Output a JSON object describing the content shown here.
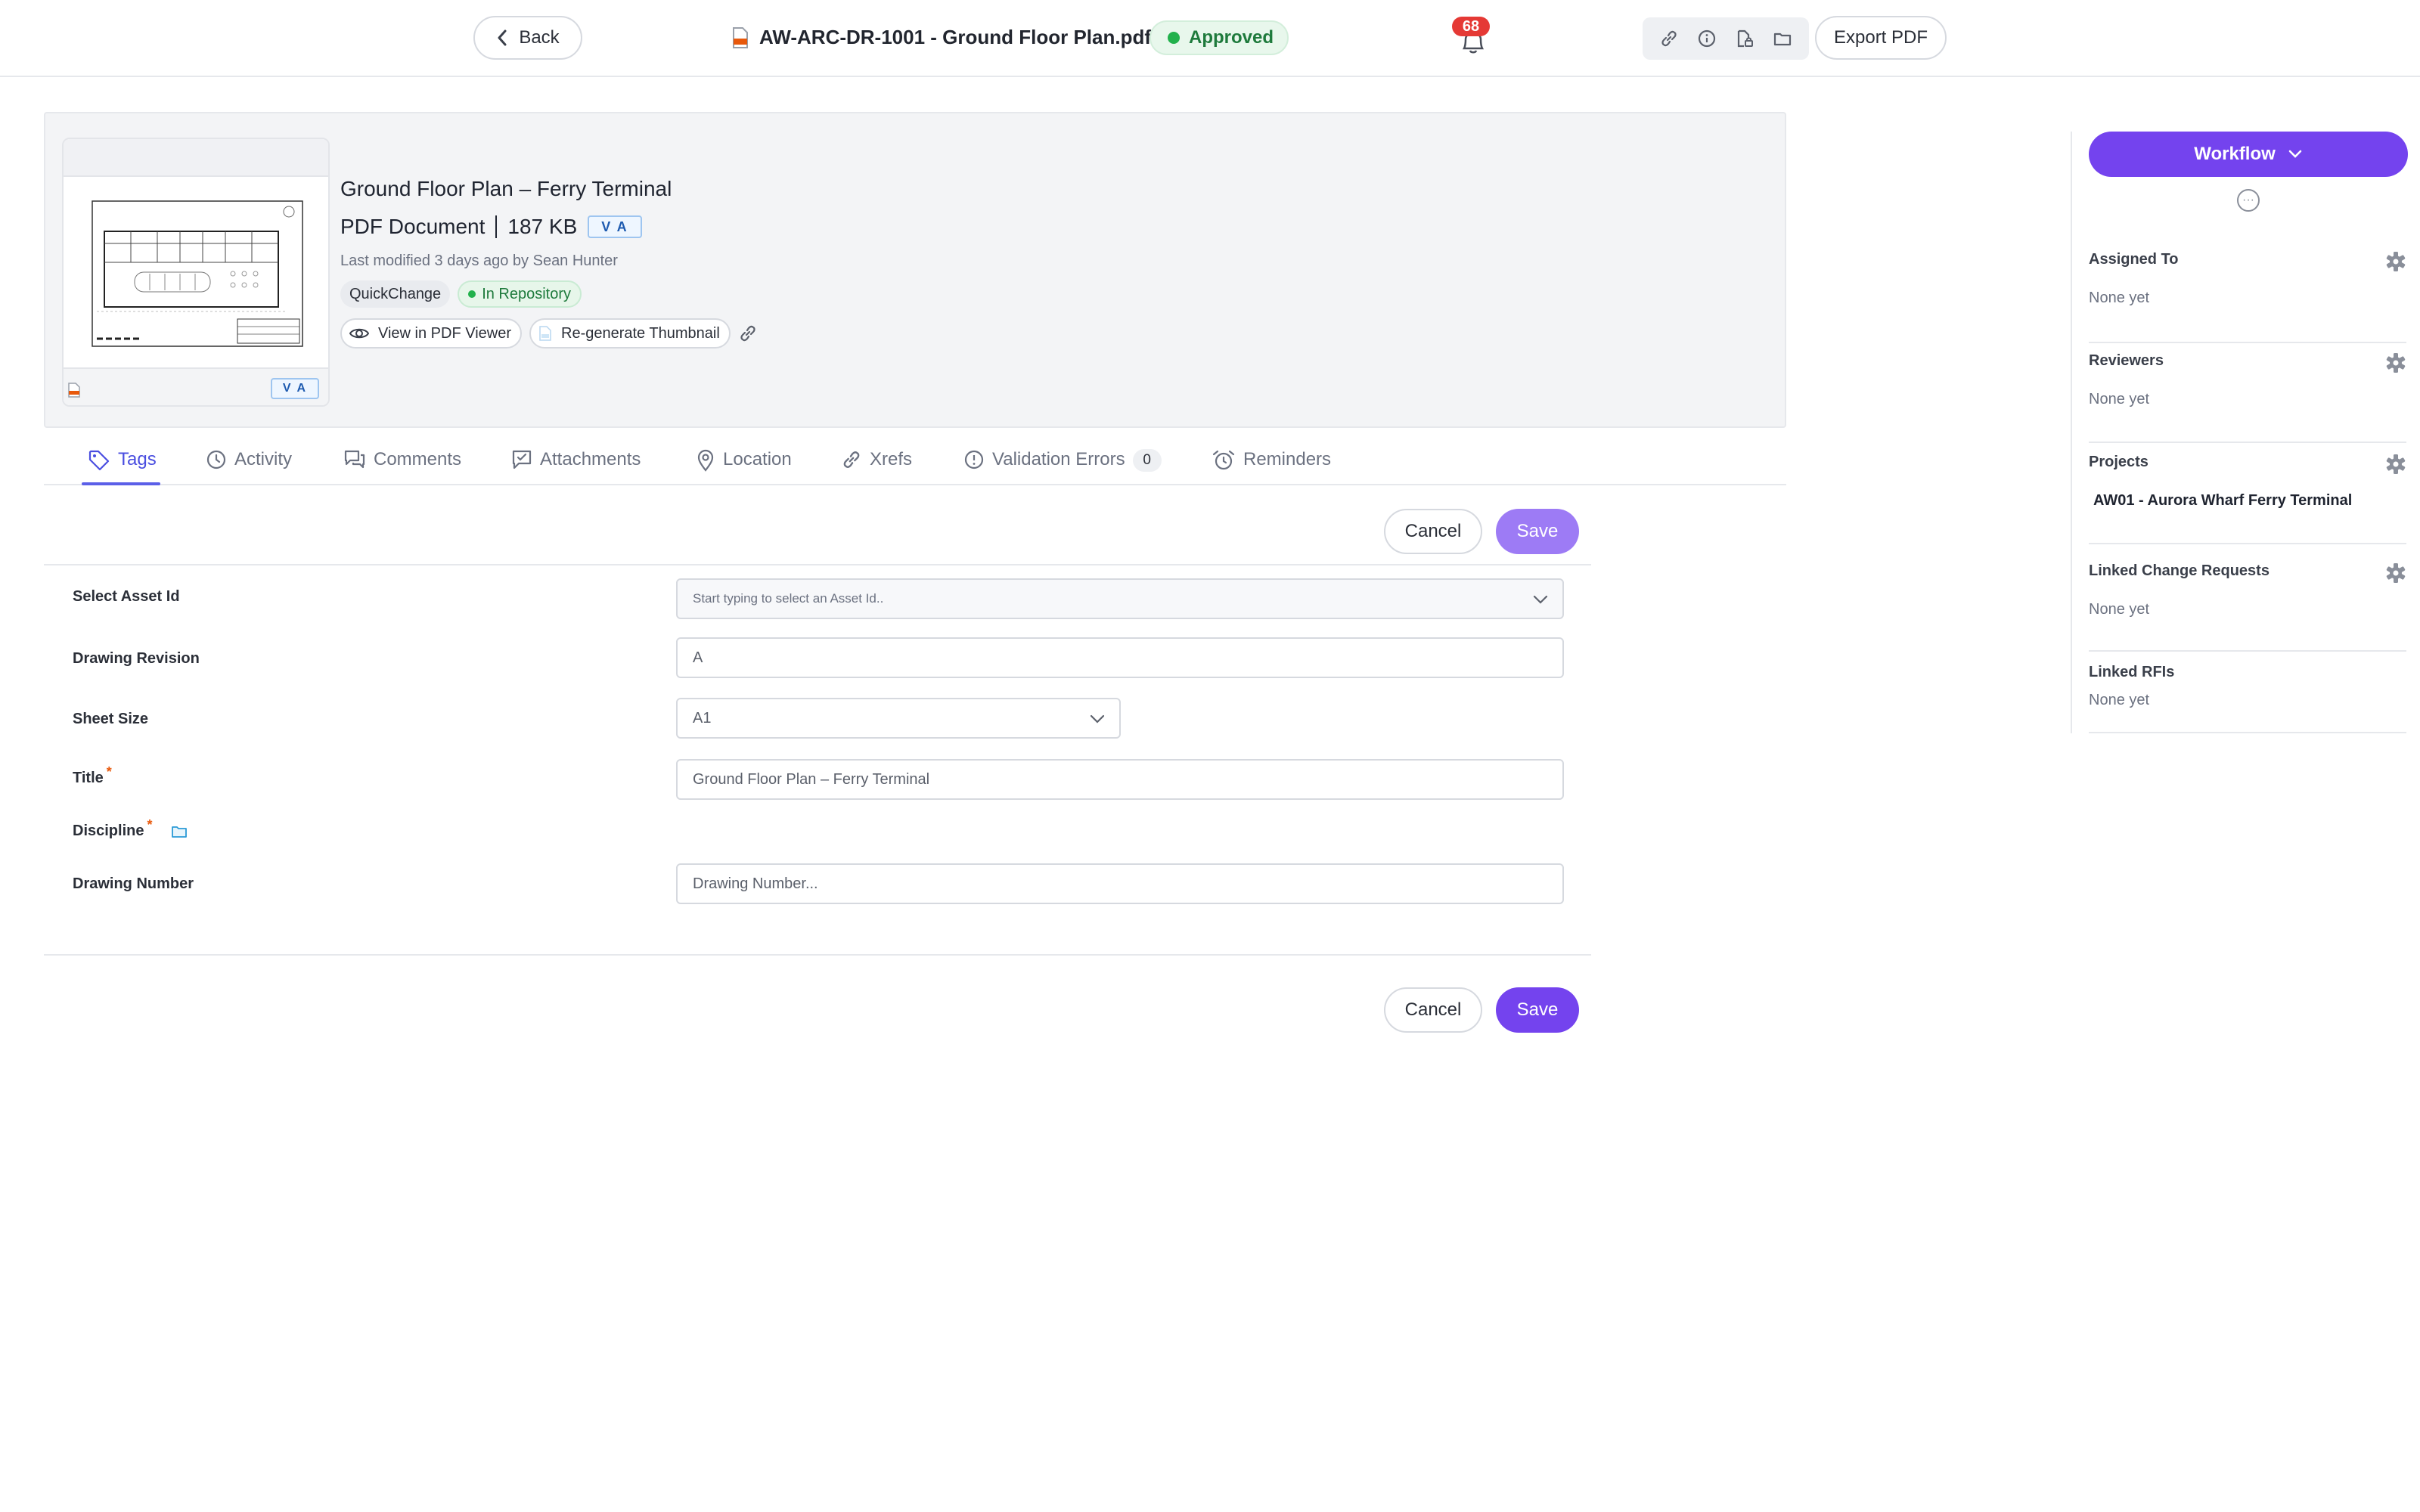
{
  "topbar": {
    "back_label": "Back",
    "file_name": "AW-ARC-DR-1001 - Ground Floor Plan.pdf",
    "status": "Approved",
    "notification_count": "68",
    "export_label": "Export PDF",
    "icons": [
      "link-icon",
      "info-icon",
      "file-lock-icon",
      "folder-icon"
    ]
  },
  "document": {
    "title": "Ground Floor Plan – Ferry Terminal",
    "type": "PDF Document",
    "size": "187 KB",
    "version": "V A",
    "modified": "Last modified 3 days ago by Sean Hunter",
    "chips": [
      "QuickChange",
      "In Repository"
    ],
    "view_label": "View in PDF Viewer",
    "regen_label": "Re-generate Thumbnail",
    "thumb_version": "V A"
  },
  "tabs": [
    {
      "label": "Tags",
      "icon": "tag-icon"
    },
    {
      "label": "Activity",
      "icon": "clock-icon"
    },
    {
      "label": "Comments",
      "icon": "comments-icon"
    },
    {
      "label": "Attachments",
      "icon": "attachment-icon"
    },
    {
      "label": "Location",
      "icon": "location-pin-icon"
    },
    {
      "label": "Xrefs",
      "icon": "link-icon"
    },
    {
      "label": "Validation Errors",
      "icon": "alert-circle-icon",
      "count": "0"
    },
    {
      "label": "Reminders",
      "icon": "alarm-icon"
    }
  ],
  "form": {
    "cancel_label": "Cancel",
    "save_label": "Save",
    "fields": [
      {
        "label": "Select Asset Id",
        "placeholder": "Start typing to select an Asset Id.."
      },
      {
        "label": "Drawing Revision",
        "value": "A"
      },
      {
        "label": "Sheet Size",
        "value": "A1"
      },
      {
        "label": "Title",
        "value": "Ground Floor Plan – Ferry Terminal",
        "required": "*"
      },
      {
        "label": "Discipline",
        "required": "*"
      },
      {
        "label": "Drawing Number",
        "placeholder": "Drawing Number..."
      }
    ]
  },
  "panel": {
    "workflow_label": "Workflow",
    "sections": [
      {
        "title": "Assigned To",
        "value": "None yet"
      },
      {
        "title": "Reviewers",
        "value": "None yet"
      },
      {
        "title": "Projects",
        "value": "AW01 - Aurora Wharf Ferry Terminal"
      },
      {
        "title": "Linked Change Requests",
        "value": "None yet"
      },
      {
        "title": "Linked RFIs",
        "value": "None yet"
      }
    ]
  },
  "colors": {
    "accent": "#7443ee",
    "tab_active": "#4a4ee0",
    "approved_green": "#22b14c",
    "badge_red": "#e53935"
  }
}
